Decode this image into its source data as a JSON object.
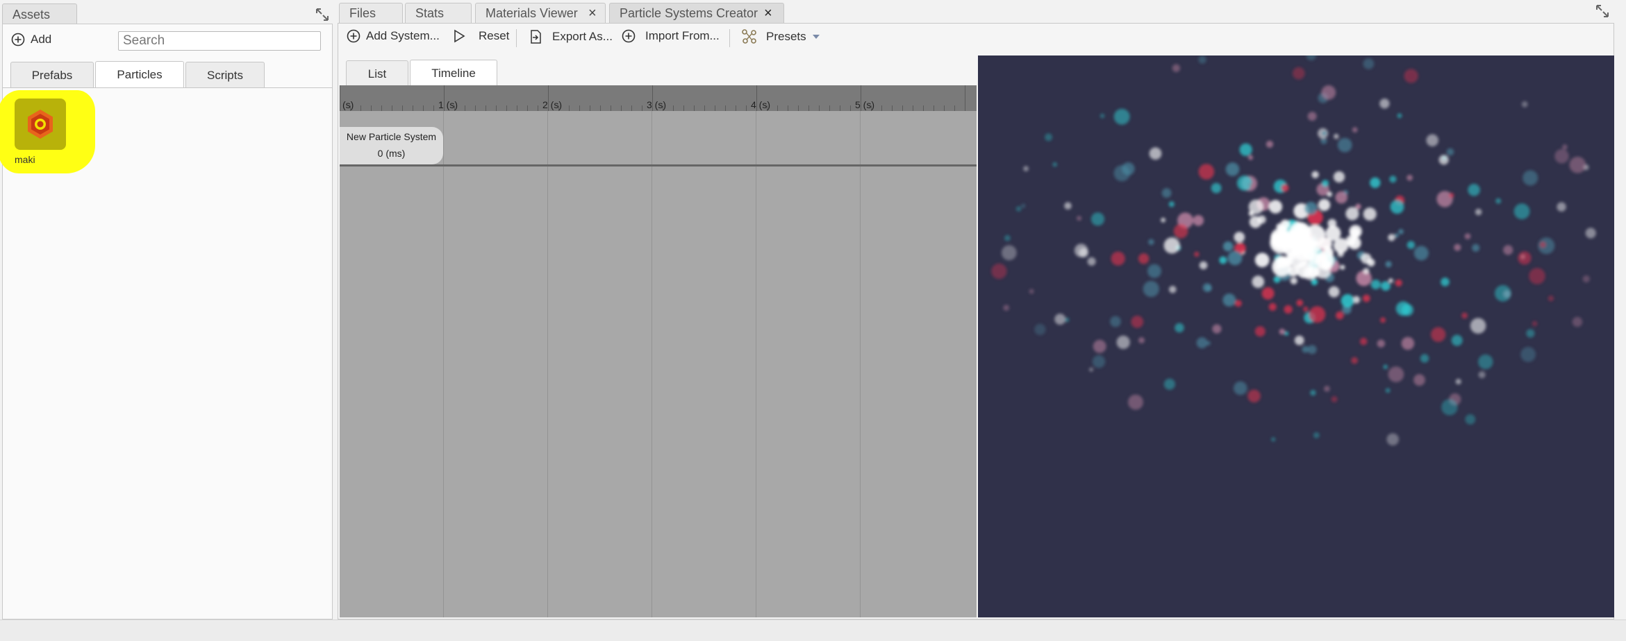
{
  "assets_panel": {
    "title": "Assets",
    "add_label": "Add",
    "search_placeholder": "Search",
    "tabs": [
      {
        "label": "Prefabs",
        "active": false
      },
      {
        "label": "Particles",
        "active": true
      },
      {
        "label": "Scripts",
        "active": false
      }
    ],
    "items": [
      {
        "label": "maki",
        "icon": "particle-asset-icon",
        "highlighted": true
      }
    ]
  },
  "document_tabs": [
    {
      "label": "Files",
      "closable": false
    },
    {
      "label": "Stats",
      "closable": false
    },
    {
      "label": "Materials Viewer",
      "closable": true
    },
    {
      "label": "Particle Systems Creator",
      "closable": true,
      "active": true
    }
  ],
  "toolbar": {
    "add_system": "Add System...",
    "reset": "Reset",
    "export_as": "Export As...",
    "import_from": "Import From...",
    "presets": "Presets"
  },
  "view_tabs": [
    {
      "label": "List",
      "active": false
    },
    {
      "label": "Timeline",
      "active": true
    }
  ],
  "timeline": {
    "ticks": [
      "(s)",
      "1 (s)",
      "2 (s)",
      "3 (s)",
      "4 (s)",
      "5 (s)"
    ],
    "systems": [
      {
        "name": "New Particle System",
        "time": "0 (ms)"
      }
    ]
  },
  "colors": {
    "preview_background": "#30314a",
    "highlight": "#ffff14",
    "particle_red": "#e0334f",
    "particle_cyan": "#2fd3d8",
    "particle_white": "#ffffff"
  }
}
